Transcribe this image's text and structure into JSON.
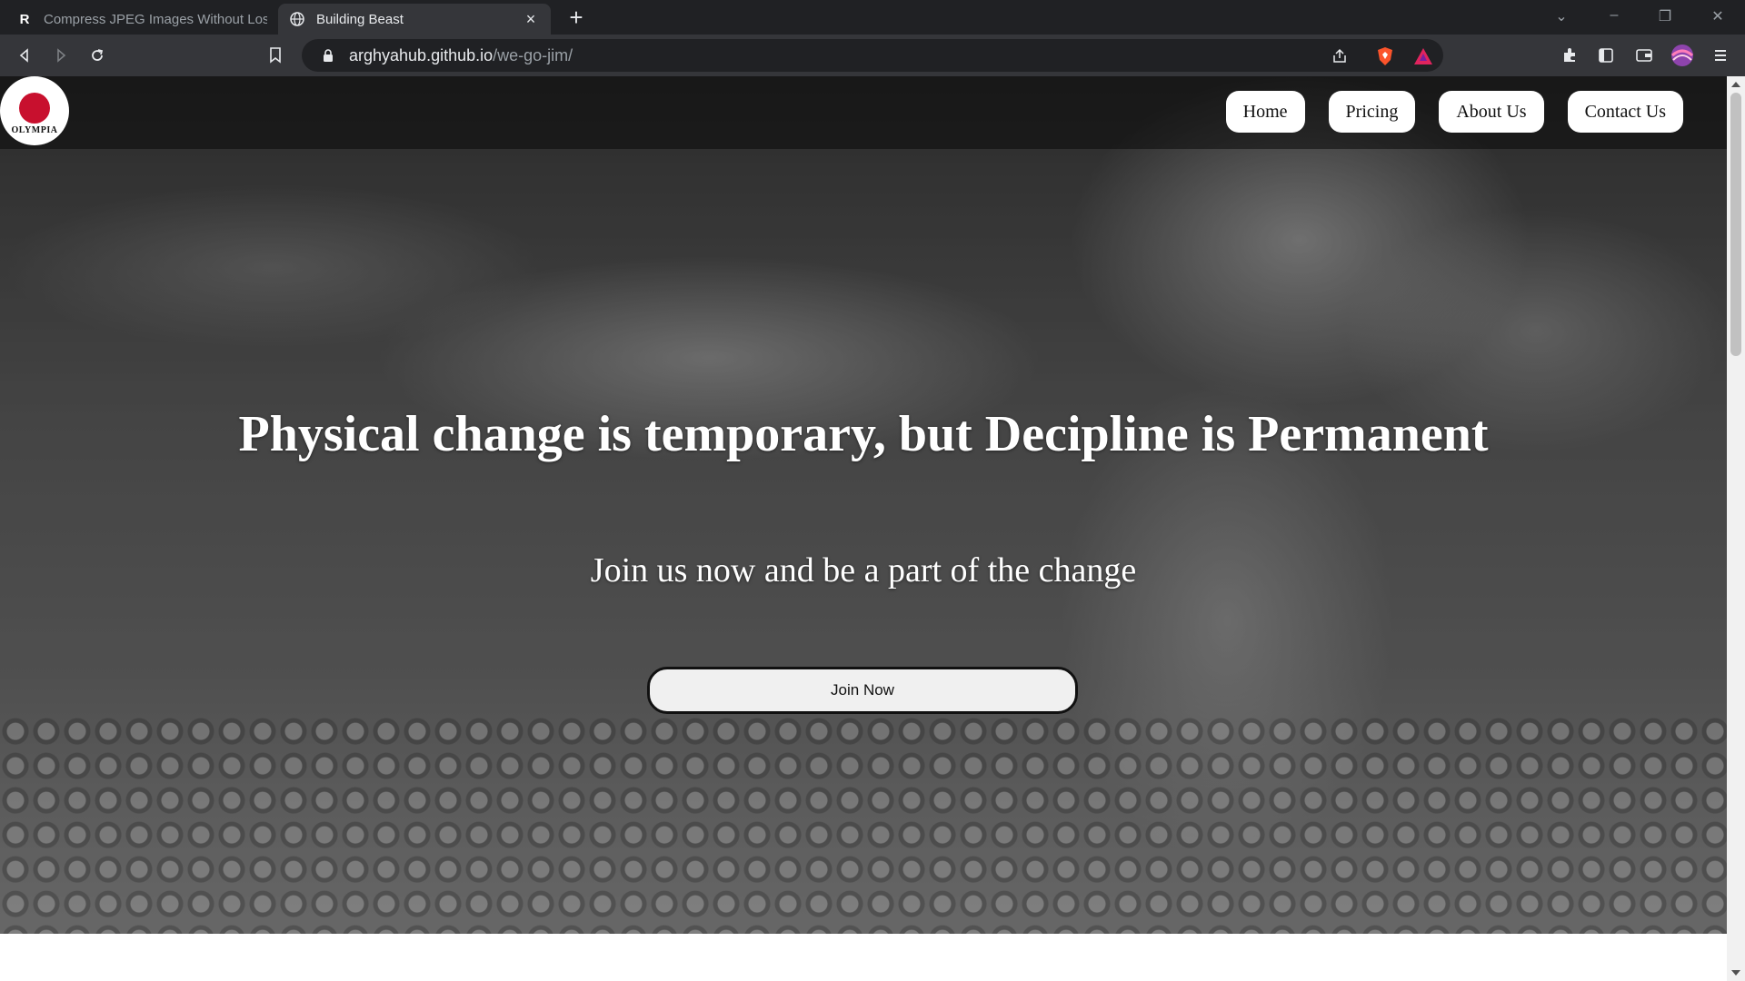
{
  "browser": {
    "tabs": [
      {
        "title": "Compress JPEG Images Without Losin",
        "favicon": "R",
        "active": false
      },
      {
        "title": "Building Beast",
        "favicon": "globe-icon",
        "active": true
      }
    ],
    "address": {
      "host": "arghyahub.github.io",
      "path": "/we-go-jim/"
    }
  },
  "site": {
    "logo": {
      "text": "OLYMPIA"
    },
    "nav": [
      {
        "label": "Home"
      },
      {
        "label": "Pricing"
      },
      {
        "label": "About Us"
      },
      {
        "label": "Contact Us"
      }
    ],
    "hero": {
      "headline": "Physical change is temporary, but Decipline is Permanent",
      "subline": "Join us now and be a part of the change",
      "cta": "Join Now"
    }
  },
  "colors": {
    "chrome_dark": "#202124",
    "chrome_toolbar": "#35363a",
    "nav_button_bg": "#ffffff",
    "cta_border": "#111111"
  }
}
